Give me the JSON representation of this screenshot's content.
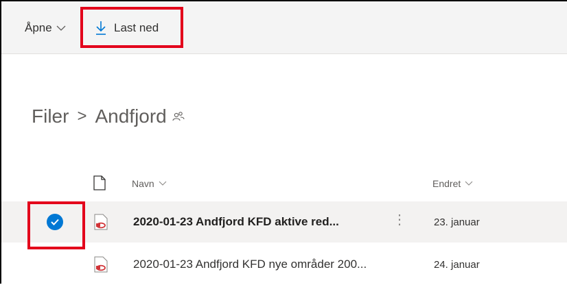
{
  "commandbar": {
    "open_label": "Åpne",
    "download_label": "Last ned"
  },
  "breadcrumb": {
    "root": "Filer",
    "separator": ">",
    "current": "Andfjord"
  },
  "columns": {
    "name": "Navn",
    "modified": "Endret"
  },
  "rows": [
    {
      "name": "2020-01-23 Andfjord KFD aktive red...",
      "modified": "23. januar",
      "selected": true
    },
    {
      "name": "2020-01-23 Andfjord KFD nye områder 200...",
      "modified": "24. januar",
      "selected": false
    }
  ],
  "colors": {
    "highlight": "#e3001b",
    "accent": "#0078d4",
    "pdf_icon": "#d13438"
  }
}
